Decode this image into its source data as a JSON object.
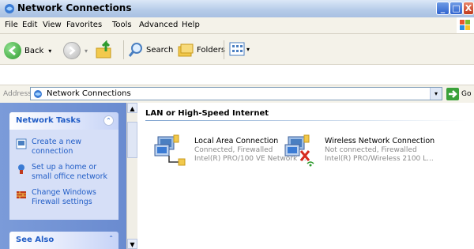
{
  "window": {
    "title": "Network Connections",
    "buttons": {
      "minimize": "_",
      "maximize": "□",
      "close": "X"
    }
  },
  "menu": {
    "items": [
      "File",
      "Edit",
      "View",
      "Favorites",
      "Tools",
      "Advanced",
      "Help"
    ]
  },
  "toolbar": {
    "back_label": "Back",
    "search_label": "Search",
    "folders_label": "Folders",
    "views_dropdown": "▾"
  },
  "address": {
    "label": "Address",
    "value": "Network Connections",
    "go_label": "Go"
  },
  "left_pane": {
    "network_tasks": {
      "title": "Network Tasks",
      "collapse_glyph": "⌃",
      "items": [
        {
          "label": "Create a new connection",
          "icon": "new-connection-icon"
        },
        {
          "label": "Set up a home or small office network",
          "icon": "home-network-icon"
        },
        {
          "label": "Change Windows Firewall settings",
          "icon": "firewall-icon"
        }
      ]
    },
    "see_also": {
      "title": "See Also",
      "collapse_glyph": "⌃"
    }
  },
  "scrollbar": {
    "up": "▲",
    "down": "▼"
  },
  "content": {
    "group_title": "LAN or High-Speed Internet",
    "connections": [
      {
        "name": "Local Area Connection",
        "status": "Connected, Firewalled",
        "device": "Intel(R) PRO/100 VE Network ...",
        "icon": "lan-connection-icon"
      },
      {
        "name": "Wireless Network Connection",
        "status": "Not connected, Firewalled",
        "device": "Intel(R) PRO/Wireless 2100 L...",
        "icon": "wireless-connection-icon"
      }
    ]
  },
  "colors": {
    "task_link": "#215dc6",
    "left_pane_bg": "#7b9bd9",
    "status_gray": "#8a8a8a"
  }
}
